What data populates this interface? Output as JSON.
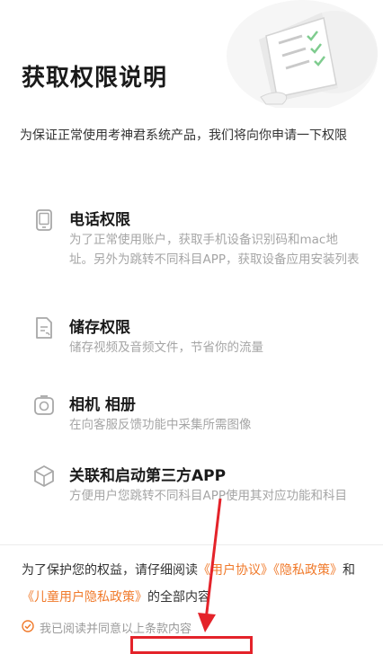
{
  "page": {
    "title": "获取权限说明"
  },
  "intro": "为保证正常使用考神君系统产品，我们将向你申请一下权限",
  "permissions": [
    {
      "icon": "phone-icon",
      "title": "电话权限",
      "desc": "为了正常使用账户，获取手机设备识别码和mac地址。另外为跳转不同科目APP，获取设备应用安装列表"
    },
    {
      "icon": "file-icon",
      "title": "储存权限",
      "desc": "储存视频及音频文件，节省你的流量"
    },
    {
      "icon": "camera-icon",
      "title": "相机 相册",
      "desc": "在向客服反馈功能中采集所需图像"
    },
    {
      "icon": "cube-icon",
      "title": "关联和启动第三方APP",
      "desc": "方便用户您跳转不同科目APP使用其对应功能和科目"
    }
  ],
  "notice": {
    "prefix": "为了保护您的权益，请仔细阅读",
    "link_user_agreement": "《用户协议》",
    "link_privacy": "《隐私政策》",
    "conjunction": "和",
    "link_child_privacy": "《儿童用户隐私政策》",
    "suffix": "的全部内容"
  },
  "agree": {
    "label": "我已阅读并同意以上条款内容",
    "checked": true
  },
  "colors": {
    "accent": "#f07a2b",
    "annotation": "#e4232a"
  }
}
